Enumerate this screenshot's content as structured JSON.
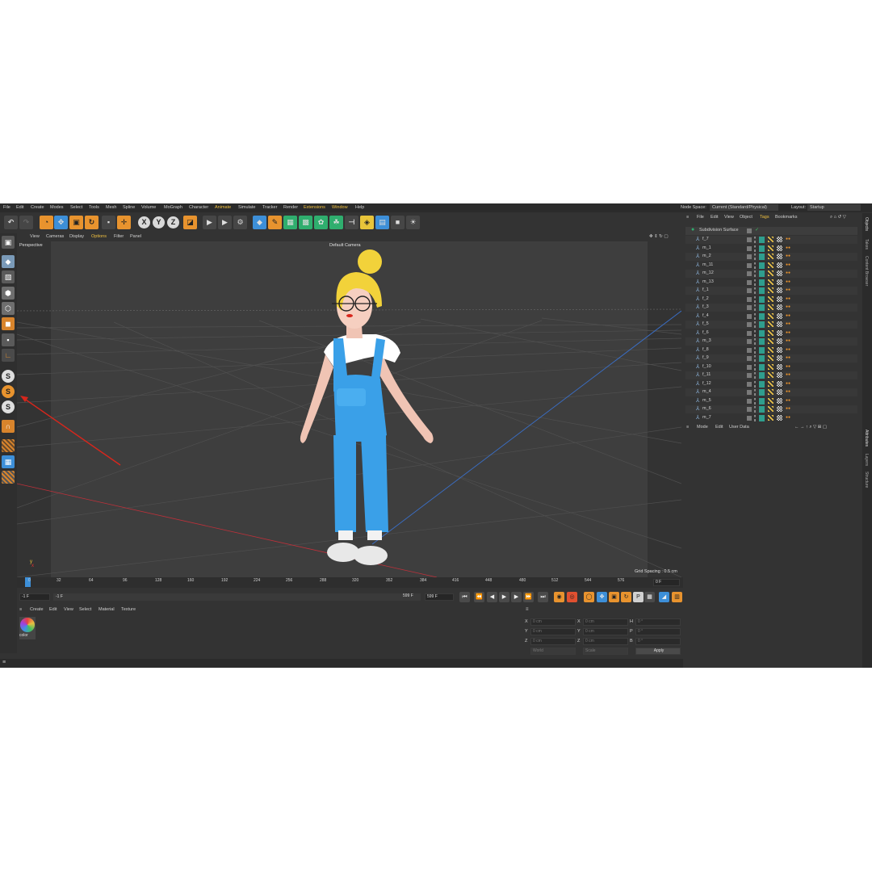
{
  "menubar": {
    "items": [
      "File",
      "Edit",
      "Create",
      "Modes",
      "Select",
      "Tools",
      "Mesh",
      "Spline",
      "Volume",
      "MoGraph",
      "Character",
      "Animate",
      "Simulate",
      "Tracker",
      "Render",
      "Extensions",
      "Window",
      "Help"
    ],
    "node_space_label": "Node Space:",
    "node_space_value": "Current (Standard/Physical)",
    "layout_label": "Layout:",
    "layout_value": "Startup"
  },
  "toolbar": {
    "axis_x": "X",
    "axis_y": "Y",
    "axis_z": "Z"
  },
  "left_tools": {
    "s1": "S",
    "s2": "S",
    "s3": "S"
  },
  "viewport": {
    "menu": [
      "View",
      "Cameras",
      "Display",
      "Options",
      "Filter",
      "Panel"
    ],
    "label": "Perspective",
    "camera": "Default Camera",
    "grid_spacing": "Grid Spacing : 0.5 cm"
  },
  "timeline": {
    "ticks": [
      "0",
      "32",
      "64",
      "96",
      "128",
      "160",
      "192",
      "224",
      "256",
      "288",
      "320",
      "352",
      "384",
      "416",
      "448",
      "480",
      "512",
      "544",
      "576"
    ],
    "current_frame": "0 F"
  },
  "transport": {
    "start": "-1 F",
    "start2": "-1 F",
    "end": "599 F",
    "end2": "599 F"
  },
  "material_manager": {
    "menu": [
      "Create",
      "Edit",
      "View",
      "Select",
      "Material",
      "Texture"
    ],
    "material_name": "color"
  },
  "coordinates": {
    "rows": [
      {
        "a": "X",
        "av": "0 cm",
        "b": "X",
        "bv": "0 cm",
        "c": "H",
        "cv": "0 °"
      },
      {
        "a": "Y",
        "av": "0 cm",
        "b": "Y",
        "bv": "0 cm",
        "c": "P",
        "cv": "0 °"
      },
      {
        "a": "Z",
        "av": "0 cm",
        "b": "Z",
        "bv": "0 cm",
        "c": "B",
        "cv": "0 °"
      }
    ],
    "mode1": "World",
    "mode2": "Scale",
    "apply": "Apply"
  },
  "objects_panel": {
    "menu": [
      "File",
      "Edit",
      "View",
      "Object",
      "Tags",
      "Bookmarks"
    ],
    "root": "Subdivision Surface",
    "items": [
      "f_7",
      "m_1",
      "m_2",
      "m_11",
      "m_12",
      "m_13",
      "f_1",
      "f_2",
      "f_3",
      "f_4",
      "f_5",
      "f_6",
      "m_3",
      "f_8",
      "f_9",
      "f_10",
      "f_11",
      "f_12",
      "m_4",
      "m_5",
      "m_6",
      "m_7"
    ]
  },
  "attributes_panel": {
    "menu": [
      "Mode",
      "Edit",
      "User Data"
    ]
  },
  "side_tabs": {
    "top": [
      "Objects",
      "Takes",
      "Content Browser"
    ],
    "bottom": [
      "Attributes",
      "Layers",
      "Structure"
    ]
  },
  "colors": {
    "accent_orange": "#e8932e",
    "accent_blue": "#3d8fd8",
    "overalls_blue": "#3aa0e8",
    "hair_yellow": "#f2d23a",
    "annotation_red": "#d8261c"
  }
}
